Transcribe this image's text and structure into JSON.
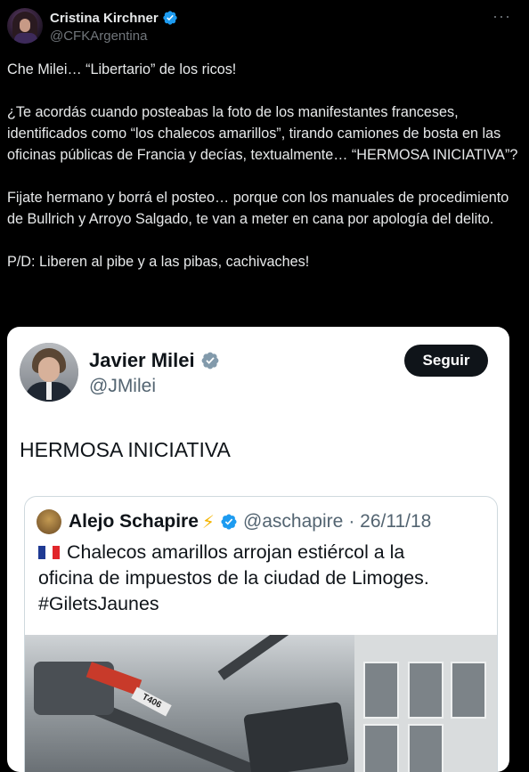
{
  "tweet": {
    "author_name": "Cristina Kirchner",
    "author_handle": "@CFKArgentina",
    "more_label": "···",
    "paragraphs": [
      "Che Milei… “Libertario” de los ricos!",
      "¿Te acordás cuando posteabas la foto de los manifestantes franceses, identificados como “los chalecos amarillos”, tirando camiones de bosta en las oficinas públicas de Francia y decías, textualmente… “HERMOSA INICIATIVA”?",
      "Fijate hermano y borrá el posteo… porque con los manuales de procedimiento de Bullrich y Arroyo Salgado, te van a meter en cana por apología del delito.",
      "P/D: Liberen al pibe y a las pibas, cachivaches!"
    ]
  },
  "embedded_tweet": {
    "author_name": "Javier Milei",
    "author_handle": "@JMilei",
    "follow_label": "Seguir",
    "text": "HERMOSA INICIATIVA"
  },
  "quoted_tweet": {
    "author_name": "Alejo Schapire",
    "bolt": "⚡",
    "author_handle": "@aschapire",
    "date": "· 26/11/18",
    "text_line1": "Chalecos amarillos arrojan estiércol a la",
    "text_line2": "oficina de impuestos de la ciudad de Limoges.",
    "text_line3": "#GiletsJaunes",
    "image_label": "T406"
  },
  "colors": {
    "background": "#000000",
    "text": "#e7e9ea",
    "muted": "#71767b",
    "verified_blue": "#1d9bf0",
    "card_bg": "#ffffff"
  }
}
